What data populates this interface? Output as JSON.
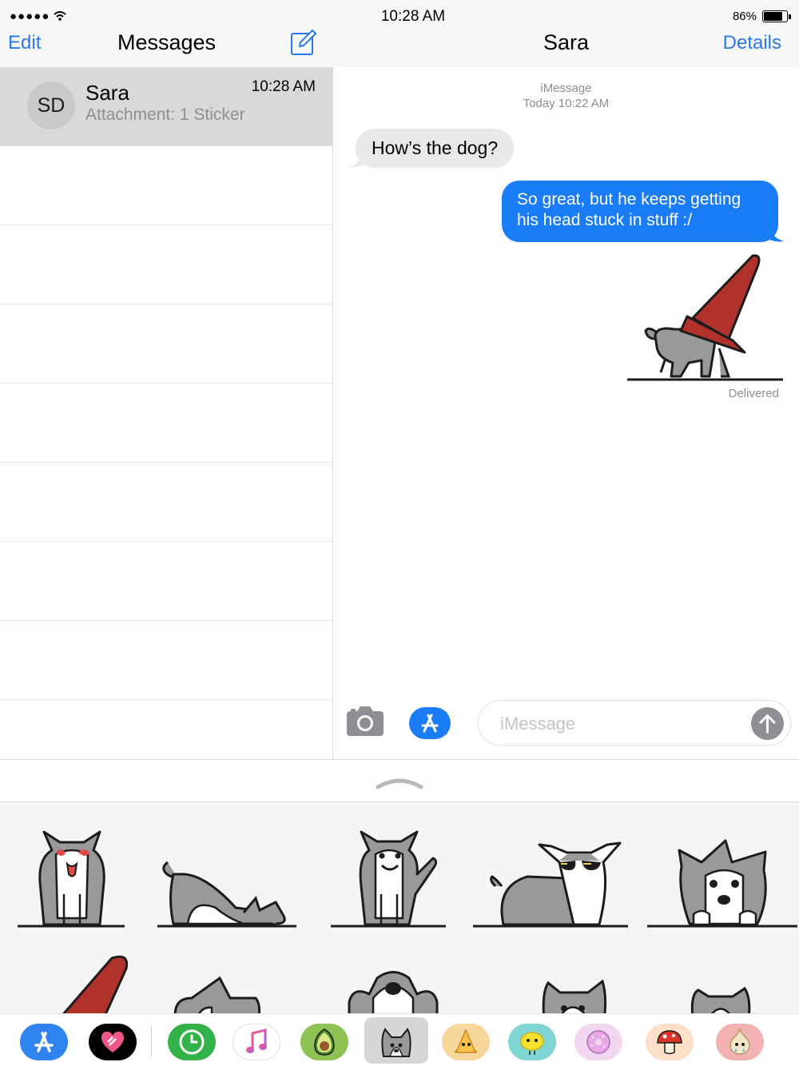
{
  "status": {
    "signal": "●●●●●",
    "time": "10:28 AM",
    "battery": "86%",
    "battery_level": 0.86
  },
  "sidebar": {
    "edit_label": "Edit",
    "title": "Messages",
    "conversations": [
      {
        "initials": "SD",
        "name": "Sara",
        "preview": "Attachment: 1 Sticker",
        "time": "10:28 AM"
      }
    ]
  },
  "chat": {
    "title": "Sara",
    "details_label": "Details",
    "service": "iMessage",
    "date": "Today 10:22 AM",
    "messages": [
      {
        "direction": "in",
        "text": "How’s the dog?"
      },
      {
        "direction": "out",
        "text": "So great, but he keeps getting his head stuck in stuff :/"
      }
    ],
    "delivered": "Delivered",
    "input_placeholder": "iMessage"
  },
  "colors": {
    "accent": "#2778e8",
    "bubble_out": "#1a7cf7",
    "bubble_in": "#e9e9eb",
    "cone": "#b0322a"
  },
  "drawer": {
    "apps": [
      {
        "name": "app-store-icon"
      },
      {
        "name": "digital-touch-icon"
      },
      {
        "name": "recents-icon"
      },
      {
        "name": "music-icon"
      },
      {
        "name": "avocado-sticker-app-icon"
      },
      {
        "name": "dog-sticker-app-icon",
        "selected": true
      },
      {
        "name": "cheese-sticker-app-icon"
      },
      {
        "name": "lemon-sticker-app-icon"
      },
      {
        "name": "donut-sticker-app-icon"
      },
      {
        "name": "mushroom-sticker-app-icon"
      },
      {
        "name": "onion-sticker-app-icon"
      }
    ]
  }
}
